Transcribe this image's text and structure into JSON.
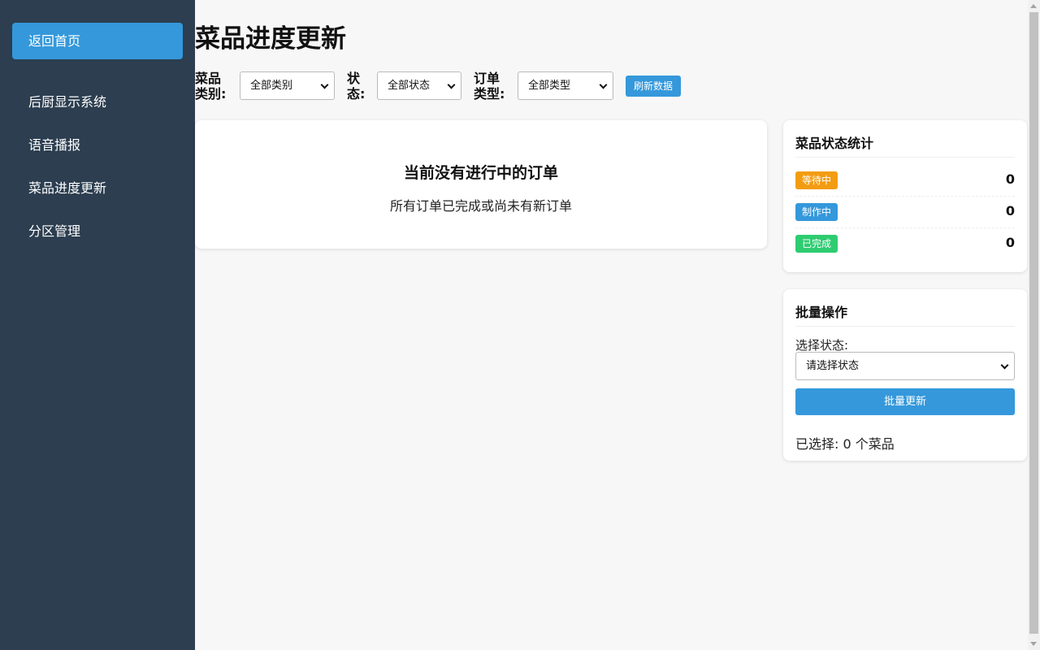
{
  "sidebar": {
    "home_label": "返回首页",
    "items": [
      {
        "label": "后厨显示系统"
      },
      {
        "label": "语音播报"
      },
      {
        "label": "菜品进度更新"
      },
      {
        "label": "分区管理"
      }
    ]
  },
  "page": {
    "title": "菜品进度更新"
  },
  "filters": {
    "category_label_line1": "菜品",
    "category_label_line2": "类别:",
    "category_value": "全部类别",
    "status_label_line1": "状",
    "status_label_line2": "态:",
    "status_value": "全部状态",
    "order_type_label_line1": "订单",
    "order_type_label_line2": "类型:",
    "order_type_value": "全部类型",
    "refresh_label": "刷新数据"
  },
  "orders": {
    "empty_title": "当前没有进行中的订单",
    "empty_subtitle": "所有订单已完成或尚未有新订单"
  },
  "stats": {
    "title": "菜品状态统计",
    "rows": [
      {
        "label": "等待中",
        "count": "0",
        "color": "#f39c12"
      },
      {
        "label": "制作中",
        "count": "0",
        "color": "#3498db"
      },
      {
        "label": "已完成",
        "count": "0",
        "color": "#2ecc71"
      }
    ]
  },
  "batch": {
    "title": "批量操作",
    "select_label": "选择状态:",
    "select_placeholder": "请选择状态",
    "update_label": "批量更新",
    "selected_text": "已选择: 0 个菜品"
  },
  "colors": {
    "sidebar_bg": "#2c3e50",
    "accent": "#3498db",
    "page_bg": "#f7f7f7"
  }
}
